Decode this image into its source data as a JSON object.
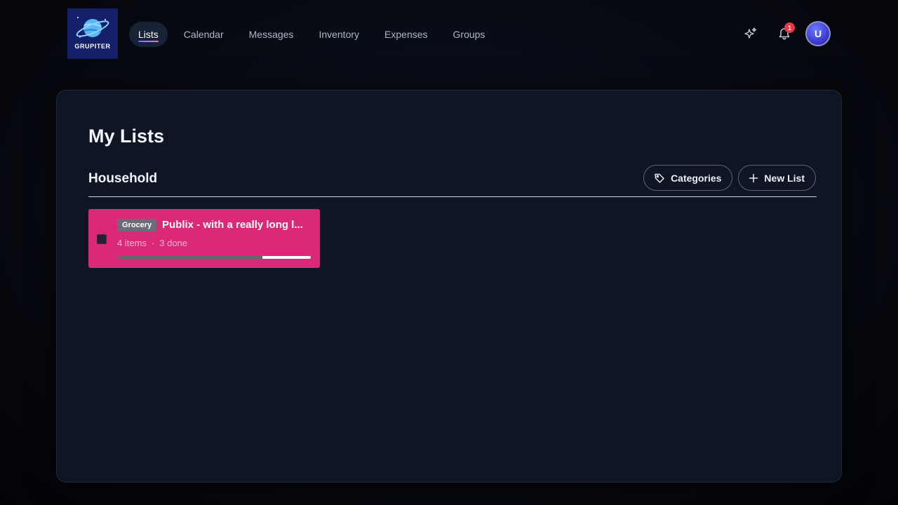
{
  "app": {
    "logo_text": "GRUPITER"
  },
  "nav": {
    "items": [
      {
        "label": "Lists",
        "active": true
      },
      {
        "label": "Calendar",
        "active": false
      },
      {
        "label": "Messages",
        "active": false
      },
      {
        "label": "Inventory",
        "active": false
      },
      {
        "label": "Expenses",
        "active": false
      },
      {
        "label": "Groups",
        "active": false
      }
    ]
  },
  "header": {
    "ai_icon": "sparkles-icon",
    "notifications_icon": "bell-icon",
    "notifications_count": "1",
    "avatar_initial": "U"
  },
  "main": {
    "title": "My Lists",
    "group": {
      "title": "Household",
      "categories_label": "Categories",
      "new_list_label": "New List"
    },
    "lists": [
      {
        "tag": "Grocery",
        "title": "Publix - with a really long l...",
        "items_text": "4 items",
        "separator": "·",
        "done_text": "3 done",
        "progress": 0.75,
        "color": "#dc2878",
        "checked": false
      }
    ]
  },
  "colors": {
    "accent": "#4f7bff",
    "card": "#dc2878",
    "badge": "#e53946",
    "panel": "#0e1624"
  }
}
